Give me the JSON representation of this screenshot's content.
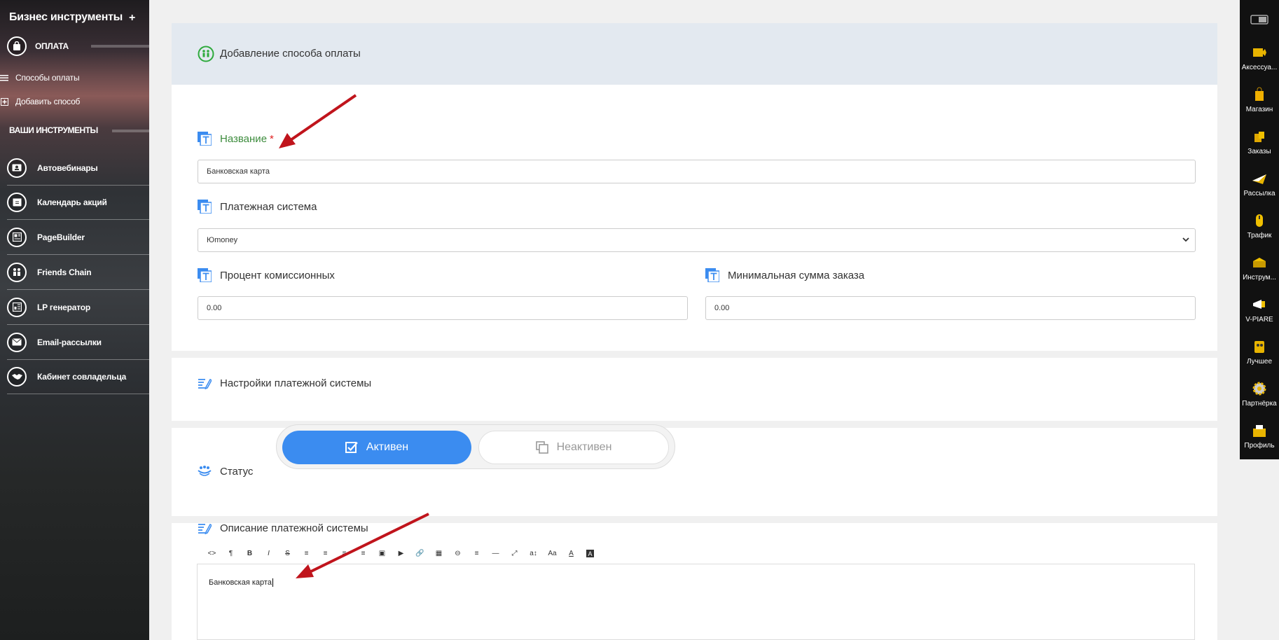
{
  "sidebar": {
    "title": "Бизнес инструменты",
    "plus": "+",
    "section": "ОПЛАТА",
    "sub_items": [
      "Способы оплаты",
      "Добавить способ"
    ],
    "tools_heading": "ВАШИ ИНСТРУМЕНТЫ",
    "items": [
      {
        "label": "Автовебинары",
        "icon": "webinar-icon"
      },
      {
        "label": "Календарь акций",
        "icon": "calendar-icon"
      },
      {
        "label": "PageBuilder",
        "icon": "pagebuilder-icon"
      },
      {
        "label": "Friends Chain",
        "icon": "friends-icon"
      },
      {
        "label": "LP генератор",
        "icon": "lp-icon"
      },
      {
        "label": "Email-рассылки",
        "icon": "email-icon"
      },
      {
        "label": "Кабинет совладельца",
        "icon": "handshake-icon"
      }
    ]
  },
  "rightbar": {
    "items": [
      "Аксессуа...",
      "Магазин",
      "Заказы",
      "Рассылка",
      "Трафик",
      "Инструм...",
      "V-PIARE",
      "Лучшее",
      "Партнёрка",
      "Профиль"
    ]
  },
  "form": {
    "header_title": "Добавление способа оплаты",
    "name_label": "Название",
    "required_mark": "*",
    "name_value": "Банковская карта",
    "payment_system_label": "Платежная система",
    "payment_system_value": "Юmoney",
    "commission_label": "Процент комиссионных",
    "commission_value": "0.00",
    "min_sum_label": "Минимальная сумма заказа",
    "min_sum_value": "0.00",
    "settings_label": "Настройки платежной системы",
    "status_label": "Статус",
    "status_active": "Активен",
    "status_inactive": "Неактивен",
    "description_label": "Описание платежной системы",
    "description_value": "Банковская карта",
    "toolbar_buttons": [
      "<>",
      "¶",
      "B",
      "I",
      "S",
      "≡",
      "≡",
      "≡",
      "≡",
      "▣",
      "▶",
      "🔗",
      "▦",
      "⊖",
      "≡",
      "—",
      "⤢",
      "a↕",
      "Aa",
      "A",
      "A"
    ]
  },
  "colors": {
    "accent_blue": "#3b8cf0",
    "arrow_red": "#c0141c",
    "label_green": "#3d8c3d"
  }
}
